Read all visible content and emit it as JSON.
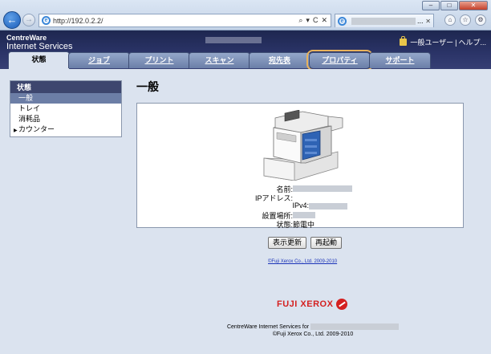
{
  "browser": {
    "window_buttons": [
      "–",
      "□",
      "✕"
    ],
    "url": "http://192.0.2.2/",
    "address_tools": [
      "⌕",
      "▾",
      "C",
      "✕"
    ],
    "tab_ellipsis": "...",
    "tab_close": "✕",
    "chrome_icons": [
      "⌂",
      "☆",
      "⚙"
    ]
  },
  "header": {
    "brand_line1": "CentreWare",
    "brand_line2": "Internet Services",
    "user_label": "一般ユーザー",
    "separator": "|",
    "help_label": "ヘルプ..."
  },
  "tabs": [
    {
      "label": "状態"
    },
    {
      "label": "ジョブ"
    },
    {
      "label": "プリント"
    },
    {
      "label": "スキャン"
    },
    {
      "label": "宛先表"
    },
    {
      "label": "プロパティ"
    },
    {
      "label": "サポート"
    }
  ],
  "sidebar": {
    "title": "状態",
    "items": [
      {
        "label": "一般"
      },
      {
        "label": "トレイ"
      },
      {
        "label": "消耗品"
      },
      {
        "label": "カウンター"
      }
    ]
  },
  "main": {
    "title": "一般",
    "info": {
      "name_label": "名前:",
      "ip_label": "IPアドレス:",
      "ipv4_label": "IPv4:",
      "location_label": "設置場所:",
      "status_label": "状態:",
      "status_value": "節電中"
    },
    "refresh_label": "表示更新",
    "restart_label": "再起動",
    "copyright_link": "©Fuji Xerox Co., Ltd. 2009-2010"
  },
  "footer": {
    "logo_text": "FUJI XEROX",
    "line1": "CentreWare Internet Services for",
    "line2": "©Fuji Xerox Co., Ltd. 2009-2010"
  },
  "colors": {
    "header_bg": "#2b3468",
    "tab_bg": "#6b7fa8",
    "page_bg": "#dbe3ef",
    "highlight": "#e8b25c",
    "brand_red": "#d42020"
  }
}
